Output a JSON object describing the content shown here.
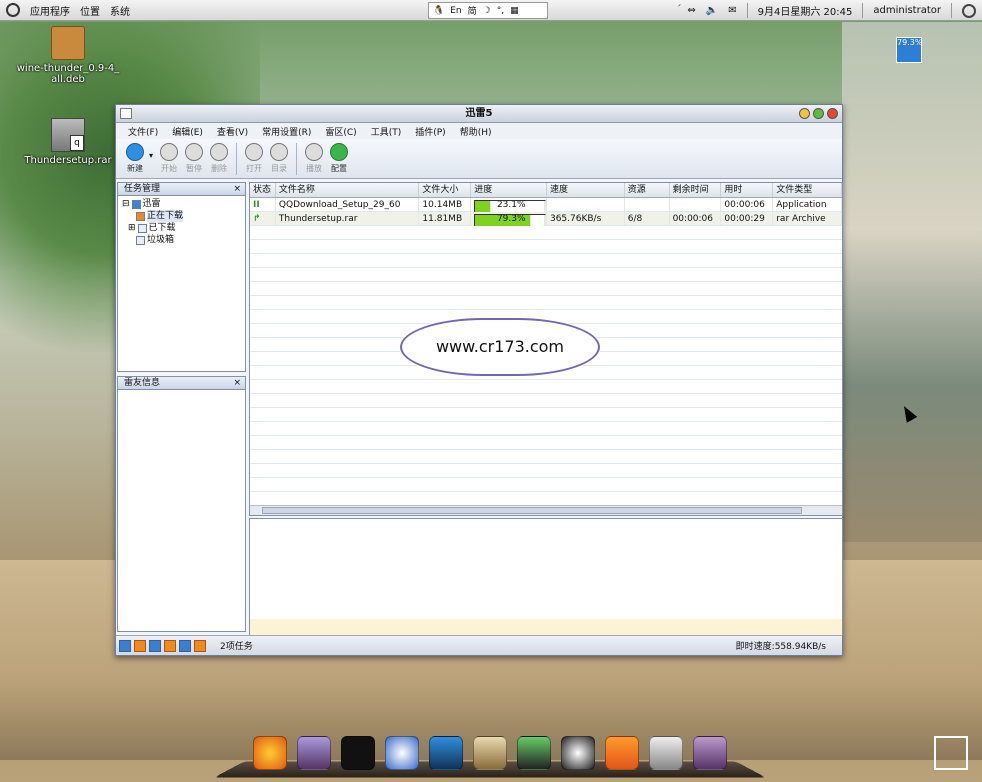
{
  "top_panel": {
    "menus": [
      "应用程序",
      "位置",
      "系统"
    ],
    "input_bar": [
      "En",
      "简",
      "☽",
      "°,",
      "▦"
    ],
    "datetime": "9月4日星期六 20:45",
    "user": "administrator"
  },
  "desktop": {
    "icons": [
      {
        "label_line1": "wine-thunder_0.9-4_",
        "label_line2": "all.deb"
      },
      {
        "label_line1": "Thundersetup.rar",
        "label_line2": ""
      }
    ],
    "mini_widget": "79.3%"
  },
  "window": {
    "title": "迅雷5",
    "menu": [
      "文件(F)",
      "编辑(E)",
      "查看(V)",
      "常用设置(R)",
      "雷区(C)",
      "工具(T)",
      "插件(P)",
      "帮助(H)"
    ],
    "toolbar": [
      {
        "label": "新建",
        "state": "active"
      },
      {
        "label": "开始",
        "state": "disabled"
      },
      {
        "label": "暂停",
        "state": "disabled"
      },
      {
        "label": "删除",
        "state": "disabled"
      },
      {
        "label": "打开",
        "state": "disabled"
      },
      {
        "label": "目录",
        "state": "disabled"
      },
      {
        "label": "播放",
        "state": "disabled"
      },
      {
        "label": "配置",
        "state": "enabled"
      }
    ],
    "task_panel": {
      "title": "任务管理",
      "close": "×",
      "tree": [
        {
          "label": "迅雷",
          "level": 0,
          "expander": "⊟"
        },
        {
          "label": "正在下载",
          "level": 1,
          "expander": "",
          "selected": true
        },
        {
          "label": "已下载",
          "level": 1,
          "expander": "⊞"
        },
        {
          "label": "垃圾箱",
          "level": 1,
          "expander": ""
        }
      ]
    },
    "friends_panel": {
      "title": "雷友信息",
      "close": "×"
    },
    "columns": [
      "状态",
      "文件名称",
      "文件大小",
      "进度",
      "速度",
      "资源",
      "剩余时间",
      "用时",
      "文件类型"
    ],
    "tasks": [
      {
        "status_icon": "pause-icon",
        "status_glyph": "II",
        "name": "QQDownload_Setup_29_60",
        "size": "10.14MB",
        "progress": 23.1,
        "progress_text": "23.1%",
        "speed": "",
        "sources": "",
        "remaining": "",
        "elapsed": "00:00:06",
        "type": "Application"
      },
      {
        "status_icon": "download-arrow-icon",
        "status_glyph": "↱",
        "name": "Thundersetup.rar",
        "size": "11.81MB",
        "progress": 79.3,
        "progress_text": "79.3%",
        "speed": "365.76KB/s",
        "sources": "6/8",
        "remaining": "00:00:06",
        "elapsed": "00:00:29",
        "type": "rar Archive"
      }
    ],
    "status": {
      "task_count": "2项任务",
      "speed": "即时速度:558.94KB/s"
    }
  },
  "watermark": "www.cr173.com",
  "colors": {
    "progress_fill": "#7ed321",
    "accent": "#2f8fe0",
    "panel_border": "#7f91ad"
  }
}
